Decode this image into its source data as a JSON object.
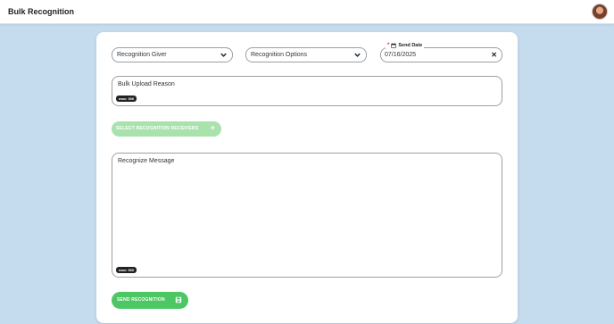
{
  "header": {
    "title": "Bulk Recognition",
    "avatar_icon": "user-avatar"
  },
  "form": {
    "giver_select": {
      "label": "Recognition Giver",
      "icon": "chevron-down-icon"
    },
    "options_select": {
      "label": "Recognition Options",
      "icon": "chevron-down-icon"
    },
    "send_date": {
      "required_mark": "*",
      "label": "Send Date",
      "value": "07/16/2025",
      "calendar_icon": "calendar-icon",
      "clear_icon": "close-icon",
      "clear_glyph": "✕"
    },
    "reason": {
      "label": "Bulk Upload Reason",
      "max_badge": "max: 300"
    },
    "receivers_button": {
      "label": "SELECT RECOGNITION RECEIVERS",
      "plus_glyph": "+"
    },
    "message": {
      "label": "Recognize Message",
      "max_badge": "max: 500"
    },
    "send_button": {
      "label": "SEND RECOGNITION",
      "icon": "save-icon"
    }
  },
  "colors": {
    "page_bg": "#c5dbee",
    "send_green": "#4cc764",
    "disabled_green": "#a9e2ad",
    "required_red": "#e02424"
  }
}
